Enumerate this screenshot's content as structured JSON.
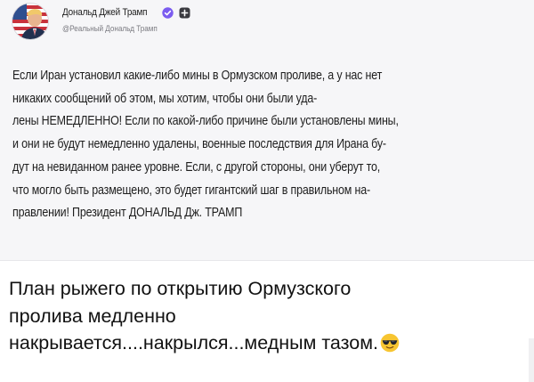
{
  "post": {
    "author_name": "Дональд Джей Трамп",
    "handle": "@Реальный Дональд Трамп",
    "text": "Если Иран установил какие-либо мины в Ормузском проливе, а у нас нет\nникаких сообщений об этом, мы хотим, чтобы они были уда-\nлены НЕМЕДЛЕННО! Если по какой-либо причине были установлены мины,\nи они не будут немедленно удалены, военные последствия для Ирана бу-\nдут на невиданном ранее уровне. Если, с другой стороны, они уберут то,\nчто могло быть размещено, это будет гигантский шаг в правильном на-\nправлении! Президент ДОНАЛЬД Дж. ТРАМП",
    "verified_badge_color": "#7b5cf0",
    "follow_badge_color": "#3b3b40"
  },
  "caption": {
    "text": "План рыжего по открытию Ормузского\nпролива медленно\nнакрывается....накрылся...медным тазом.",
    "emoji": "smiling-face-with-sunglasses"
  },
  "colors": {
    "card_background": "#f6f6f8",
    "page_background": "#ffffff"
  }
}
